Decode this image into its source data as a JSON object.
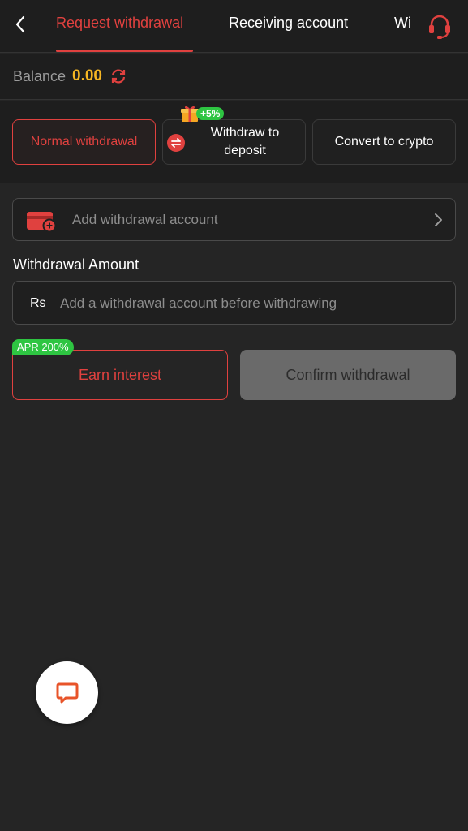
{
  "header": {
    "tabs": [
      {
        "label": "Request withdrawal",
        "active": true
      },
      {
        "label": "Receiving account",
        "active": false
      },
      {
        "label": "Wi",
        "active": false
      }
    ]
  },
  "balance": {
    "label": "Balance",
    "value": "0.00"
  },
  "methods": {
    "normal": "Normal withdrawal",
    "deposit": "Withdraw to deposit",
    "crypto": "Convert to crypto",
    "bonus_badge": "+5%"
  },
  "account": {
    "label": "Add withdrawal account"
  },
  "amount": {
    "title": "Withdrawal Amount",
    "currency": "Rs",
    "placeholder": "Add a withdrawal account before withdrawing"
  },
  "actions": {
    "earn_label": "Earn interest",
    "apr_badge": "APR 200%",
    "confirm_label": "Confirm withdrawal"
  },
  "colors": {
    "accent": "#e0413f",
    "balance": "#f5b623",
    "badge": "#2ec542",
    "disabled": "#6a6a6a"
  },
  "icons": [
    "back-icon",
    "headset-icon",
    "refresh-icon",
    "swap-icon",
    "gift-icon",
    "card-icon",
    "chevron-right-icon",
    "chat-icon"
  ]
}
